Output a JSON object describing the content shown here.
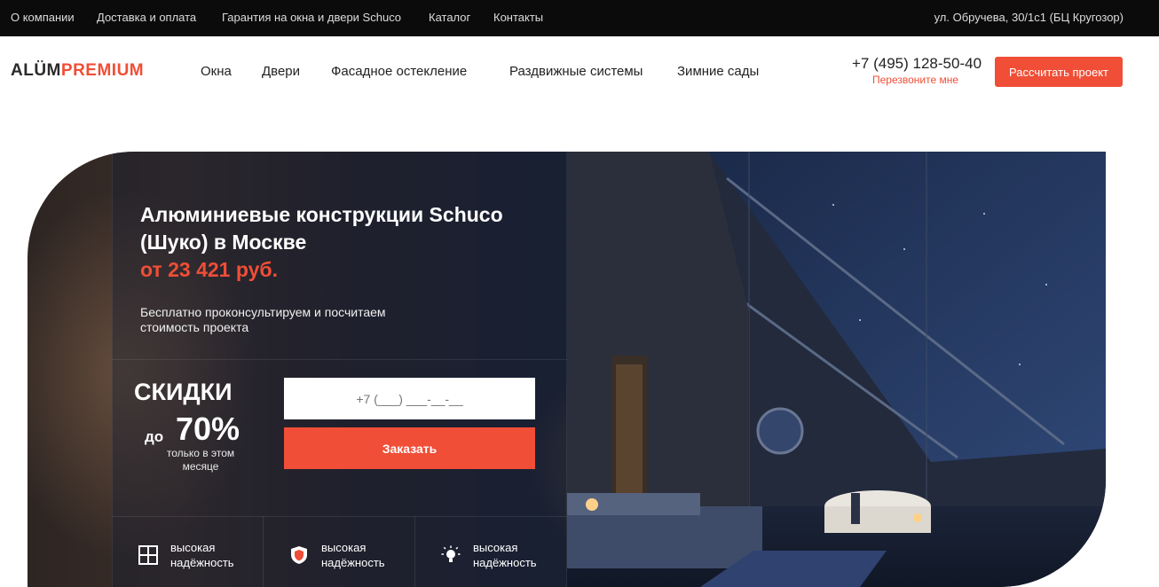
{
  "topbar": {
    "links": [
      "О компании",
      "Доставка и оплата",
      "Гарантия на окна и двери Schuco",
      "Каталог",
      "Контакты"
    ],
    "address": "ул. Обручева, 30/1с1 (БЦ Кругозор)"
  },
  "header": {
    "logo_part1": "ALÜM",
    "logo_part2": "PREMIUM",
    "nav": [
      "Окна",
      "Двери",
      "Фасадное остекление",
      "Раздвижные системы",
      "Зимние сады"
    ],
    "phone": "+7 (495) 128-50-40",
    "callback": "Перезвоните мне",
    "cta": "Рассчитать проект"
  },
  "hero": {
    "title": "Алюминиевые конструкции Schuco (Шуко) в Москве",
    "price": "от 23 421 руб.",
    "subtitle": "Бесплатно проконсультируем и посчитаем стоимость проекта",
    "discount_word": "СКИДКИ",
    "discount_prefix": "до",
    "discount_value": "70%",
    "discount_note": "только в этом месяце",
    "phone_placeholder": "+7 (___) ___-__-__",
    "order_button": "Заказать",
    "features": [
      {
        "icon": "window-icon",
        "label": "высокая надёжность"
      },
      {
        "icon": "shield-icon",
        "label": "высокая надёжность"
      },
      {
        "icon": "lightbulb-icon",
        "label": "высокая надёжность"
      }
    ]
  },
  "colors": {
    "accent": "#f04e37",
    "topbar_bg": "#0b0b0b"
  }
}
